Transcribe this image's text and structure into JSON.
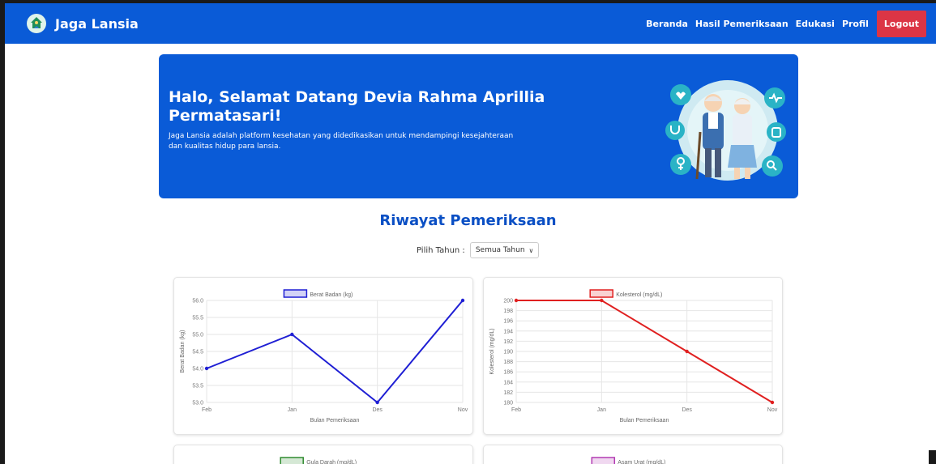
{
  "nav": {
    "brand": "Jaga Lansia",
    "links": [
      "Beranda",
      "Hasil Pemeriksaan",
      "Edukasi",
      "Profil"
    ],
    "logout": "Logout"
  },
  "hero": {
    "title": "Halo, Selamat Datang Devia Rahma Aprillia Permatasari!",
    "description": "Jaga Lansia adalah platform kesehatan yang didedikasikan untuk mendampingi kesejahteraan dan kualitas hidup para lansia."
  },
  "section": {
    "title": "Riwayat Pemeriksaan",
    "year_label": "Pilih Tahun :",
    "year_value": "Semua Tahun"
  },
  "colors": {
    "primary": "#0a5bd7",
    "logout": "#dc3545",
    "berat": "#1f1fd4",
    "kolesterol": "#e02020",
    "gula": "#2e8b2e",
    "asam": "#b23ab2"
  },
  "chart_data": [
    {
      "type": "line",
      "legend": "Berat Badan (kg)",
      "color": "#1f1fd4",
      "categories": [
        "Feb",
        "Jan",
        "Des",
        "Nov"
      ],
      "values": [
        54.0,
        55.0,
        53.0,
        56.0
      ],
      "xlabel": "Bulan Pemeriksaan",
      "ylabel": "Berat Badan (kg)",
      "ylim": [
        53.0,
        56.0
      ],
      "yticks": [
        53.0,
        53.5,
        54.0,
        54.5,
        55.0,
        55.5,
        56.0
      ],
      "grid": true,
      "legend_position": "top"
    },
    {
      "type": "line",
      "legend": "Kolesterol (mg/dL)",
      "color": "#e02020",
      "categories": [
        "Feb",
        "Jan",
        "Des",
        "Nov"
      ],
      "values": [
        200,
        200,
        190,
        180
      ],
      "xlabel": "Bulan Pemeriksaan",
      "ylabel": "Kolesterol (mg/dL)",
      "ylim": [
        180,
        200
      ],
      "yticks": [
        180,
        182,
        184,
        186,
        188,
        190,
        192,
        194,
        196,
        198,
        200
      ],
      "grid": true,
      "legend_position": "top"
    },
    {
      "type": "line",
      "legend": "Gula Darah (mg/dL)",
      "color": "#2e8b2e",
      "legend_position": "top"
    },
    {
      "type": "line",
      "legend": "Asam Urat (mg/dL)",
      "color": "#b23ab2",
      "legend_position": "top"
    }
  ]
}
